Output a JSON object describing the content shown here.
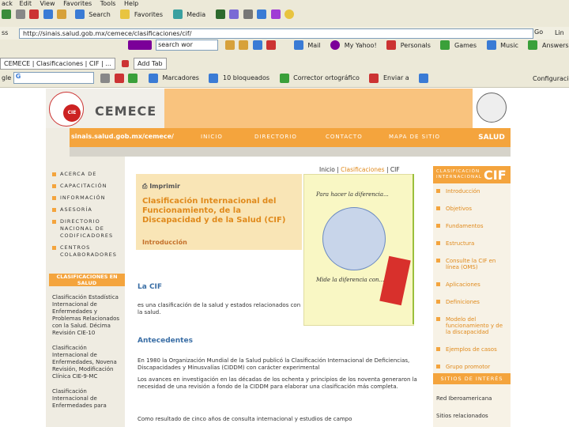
{
  "browser": {
    "menu": [
      "ack",
      "Edit",
      "View",
      "Favorites",
      "Tools",
      "Help"
    ],
    "toolbar": {
      "search": "Search",
      "favorites": "Favorites",
      "media": "Media"
    },
    "address_label": "ss",
    "address_url": "http://sinais.salud.gob.mx/cemece/clasificaciones/cif/",
    "go": "Go",
    "links": "Lin",
    "search_box": "search wor",
    "mail": "Mail",
    "myyahoo": "My Yahoo!",
    "personals": "Personals",
    "games": "Games",
    "music": "Music",
    "answers": "Answers",
    "tab_title": "CEMECE | Clasificaciones | CIF | ...",
    "add_tab": "Add Tab",
    "google_label": "gle",
    "google_g": "G",
    "marcadores": "Marcadores",
    "bloqueados": "10 bloqueados",
    "corrector": "Corrector ortográfico",
    "enviar": "Enviar a",
    "configuracion": "Configuraci"
  },
  "site": {
    "brand": "CEMECE",
    "url_prefix": "sinais.salud.gob.mx/",
    "url_bold": "cemece",
    "url_suffix": "/",
    "nav": [
      "INICIO",
      "DIRECTORIO",
      "CONTACTO",
      "MAPA DE SITIO"
    ],
    "salud": "SALUD",
    "left_menu": [
      "ACERCA DE",
      "CAPACITACIÓN",
      "INFORMACIÓN",
      "ASESORÍA",
      "DIRECTORIO NACIONAL DE CODIFICADORES",
      "CENTROS COLABORADORES"
    ],
    "clasificaciones_head": "CLASIFICACIONES EN SALUD",
    "clasificaciones": [
      "Clasificación Estadística Internacional de Enfermedades y Problemas Relacionados con la Salud. Décima Revisión CIE-10",
      "Clasificación Internacional de Enfermedades, Novena Revisión, Modificación Clínica CIE-9-MC",
      "Clasificación Internacional de Enfermedades para"
    ],
    "breadcrumb_inicio": "Inicio",
    "breadcrumb_clas": "Clasificaciones",
    "breadcrumb_cif": "CIF",
    "imprimir": "Imprimir",
    "cif_title": "Clasificación Internacional del Funcionamiento, de la Discapacidad y de la Salud (CIF)",
    "intro": "Introducción",
    "vit_caption_top": "Para hacer la diferencia...",
    "vit_caption_bottom": "Mide la diferencia con...",
    "la_cif_head": "La CIF",
    "la_cif_text": "es una clasificación de la salud y estados relacionados con la salud.",
    "antecedentes_head": "Antecedentes",
    "ant_p1": "En 1980 la Organización Mundial de la Salud publicó la Clasificación Internacional de Deficiencias, Discapacidades y Minusvalías (CIDDM) con carácter experimental",
    "ant_p2": "Los avances en investigación en las décadas de los ochenta y principios de los noventa generaron la necesidad de una revisión a fondo de la CIDDM para elaborar una clasificación más completa.",
    "ant_p3": "Como resultado de cinco años de consulta internacional y estudios de campo",
    "right_head_clas": "CLASIFICACIÓN INTERNACIONAL",
    "right_head_cif": "CIF",
    "right_menu": [
      "Introducción",
      "Objetivos",
      "Fundamentos",
      "Estructura",
      "Consulte la CIF en línea (OMS)",
      "Aplicaciones",
      "Definiciones",
      "Modelo del funcionamiento y de la discapacidad",
      "Ejemplos de casos",
      "Grupo promotor"
    ],
    "sitios_head": "SITIOS DE INTERÉS",
    "sitio1": "Red Iberoamericana",
    "sitio2": "Sitios relacionados"
  }
}
